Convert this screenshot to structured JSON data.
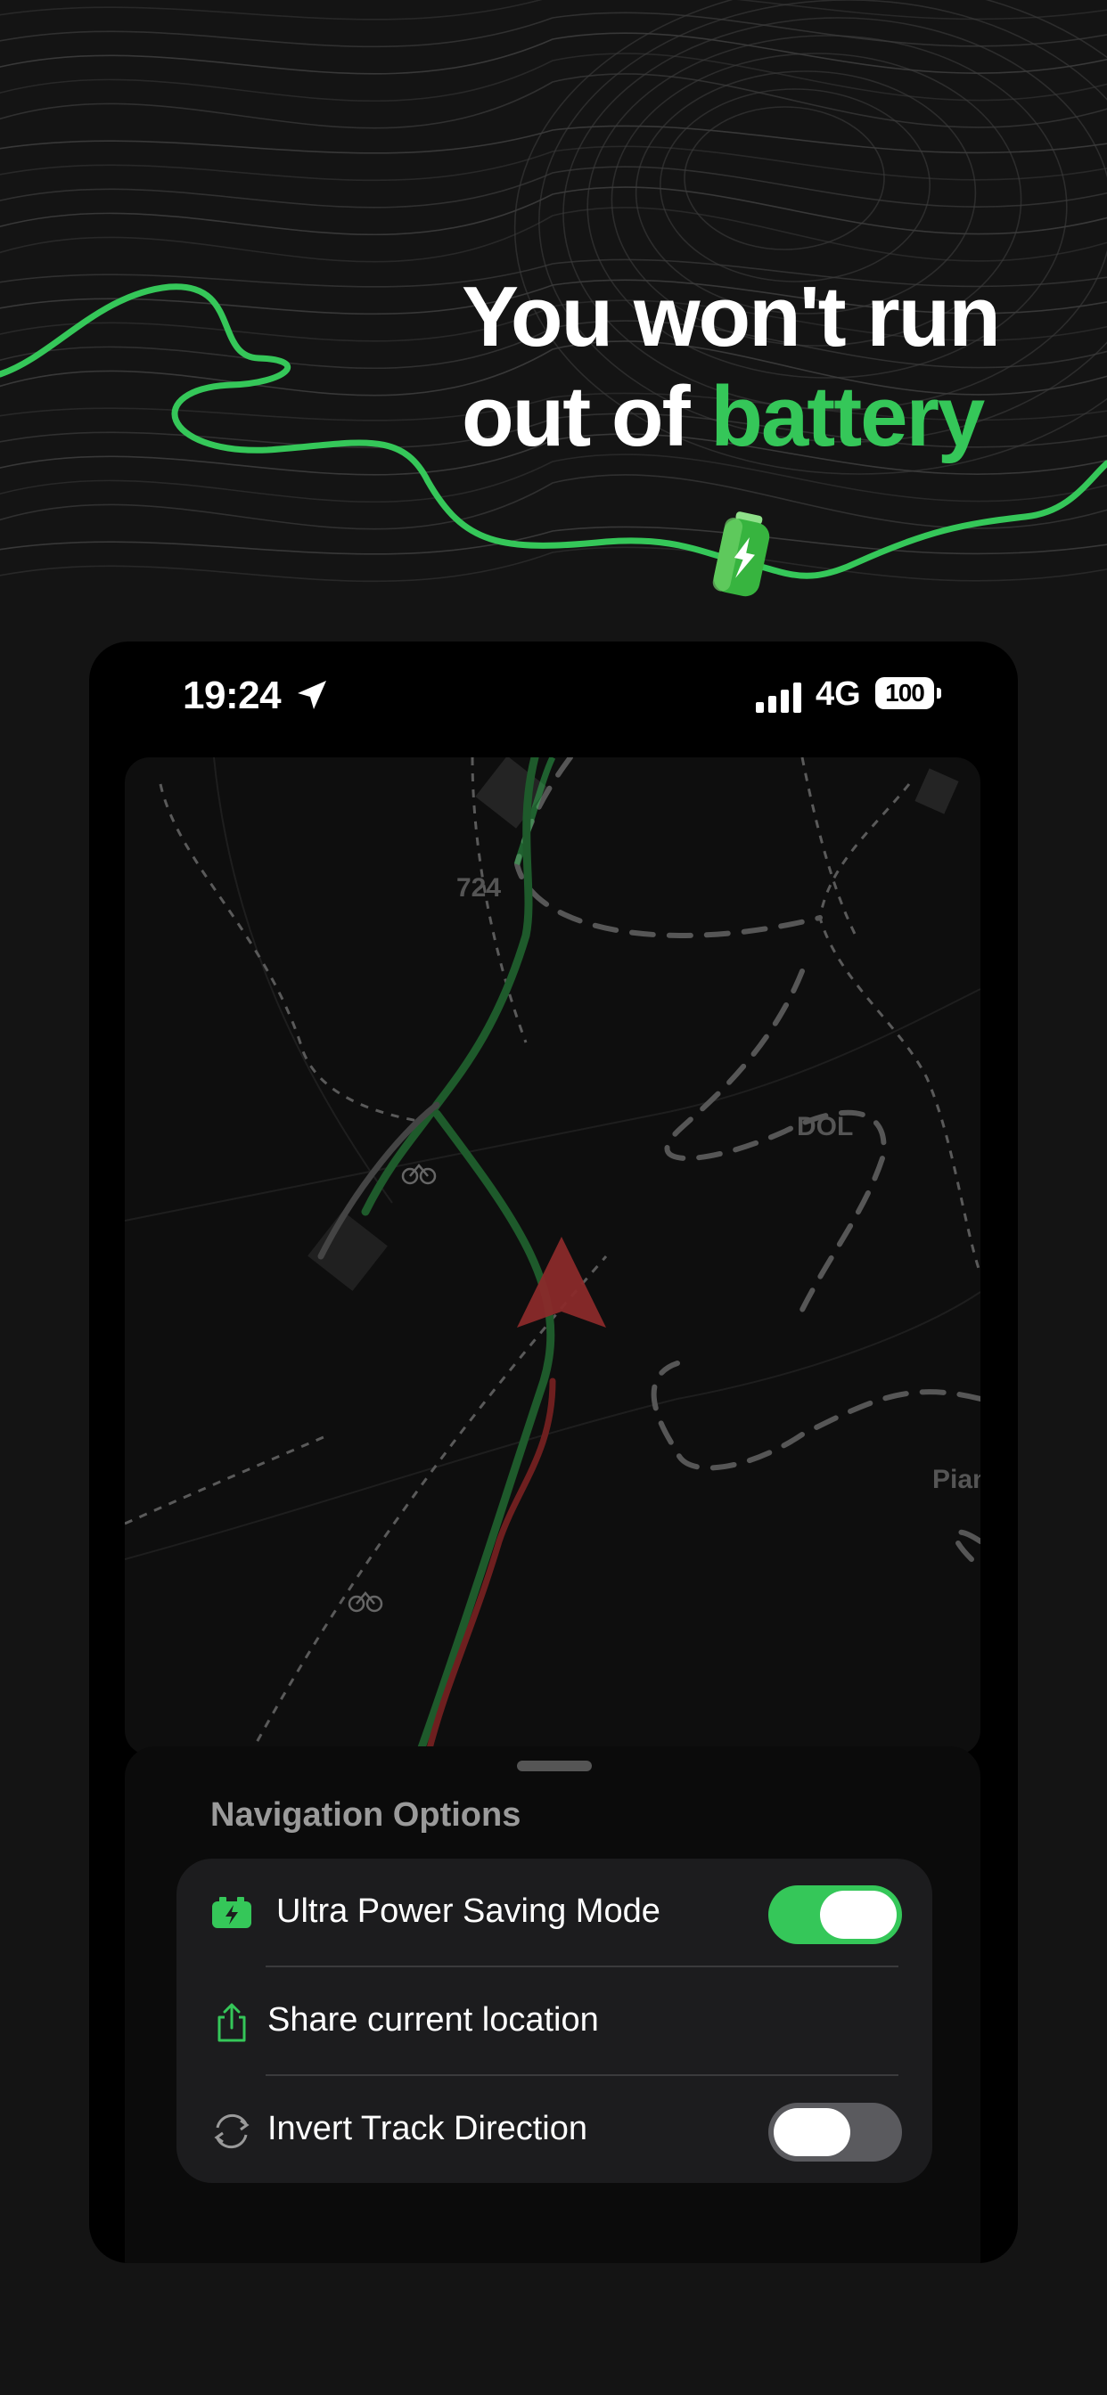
{
  "headline": {
    "line1": "You won't run",
    "line2_prefix": "out of ",
    "line2_accent": "battery"
  },
  "colors": {
    "accent": "#35c759",
    "background": "#141414",
    "card": "#1c1c1e"
  },
  "status_bar": {
    "time": "19:24",
    "network": "4G",
    "battery_level": "100"
  },
  "map": {
    "labels": {
      "elevation": "724",
      "place1": "DOL",
      "place2": "Pian"
    }
  },
  "sheet": {
    "title": "Navigation Options",
    "options": [
      {
        "label": "Ultra Power Saving Mode",
        "icon": "battery-charge-icon",
        "toggle": true,
        "enabled": true
      },
      {
        "label": "Share current location",
        "icon": "share-icon",
        "toggle": false
      },
      {
        "label": "Invert Track Direction",
        "icon": "invert-arrows-icon",
        "toggle": true,
        "enabled": false
      }
    ]
  }
}
